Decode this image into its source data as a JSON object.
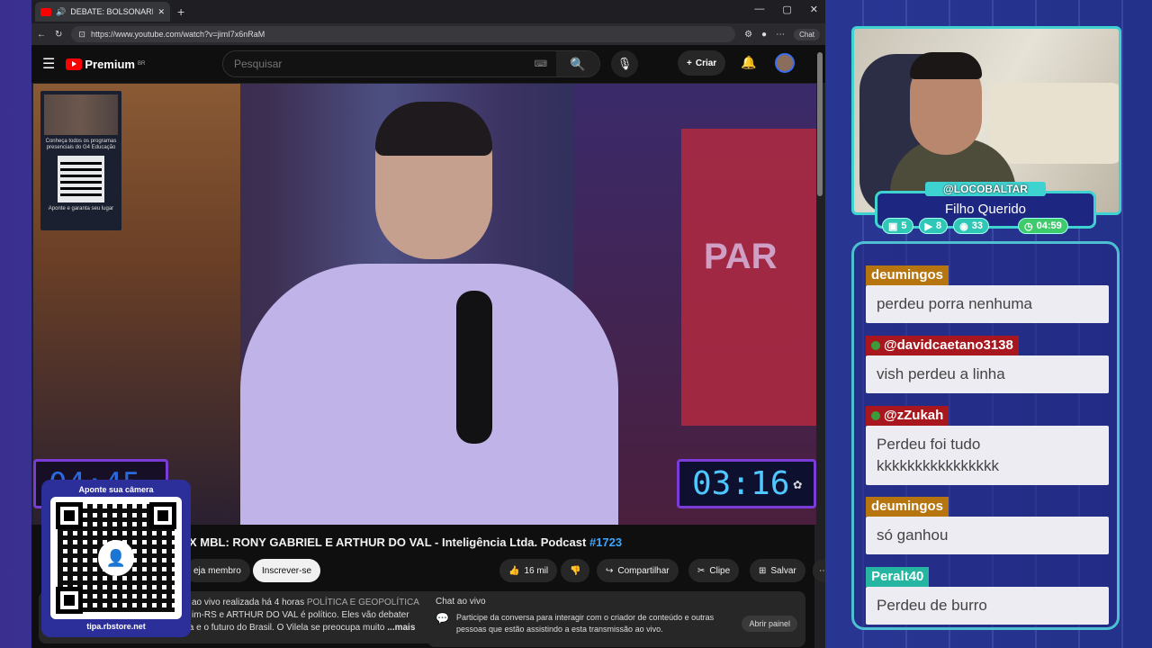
{
  "browser": {
    "tab_title": "DEBATE: BOLSONARISTA X MBL",
    "new_tab": "+",
    "win_min": "—",
    "win_max": "▢",
    "win_close": "✕",
    "url": "https://www.youtube.com/watch?v=jimI7x6nRaM",
    "chat_label": "Chat"
  },
  "youtube": {
    "logo_text": "Premium",
    "logo_region": "BR",
    "search_placeholder": "Pesquisar",
    "create_label": "Criar",
    "video": {
      "promo_text": "Conheça todos os programas presenciais do G4 Educação",
      "promo_footer": "Aponte e garanta seu lugar",
      "timer_left": "04:45",
      "timer_right": "03:16",
      "sign_text": "PAR"
    },
    "title_main": "X MBL: RONY GABRIEL E ARTHUR DO VAL - Inteligência Ltda. Podcast",
    "title_tag": "#1723",
    "actions": {
      "member": "eja membro",
      "subscribe": "Inscrever-se",
      "likes": "16 mil",
      "share": "Compartilhar",
      "clip": "Clipe",
      "save": "Salvar",
      "more": "⋯"
    },
    "description": {
      "line1": "ao vivo realizada há 4 horas",
      "category": "POLÍTICA E GEOPOLÍTICA",
      "line2": "im-RS e ARTHUR DO VAL é político. Eles vão debater",
      "line3": "sobre Bolsonaro, a política da direita e o futuro do Brasil. O Vilela se preocupa muito",
      "more": "...mais"
    },
    "live_chat": {
      "header": "Chat ao vivo",
      "text": "Participe da conversa para interagir com o criador de conteúdo e outras pessoas que estão assistindo a esta transmissão ao vivo.",
      "open_button": "Abrir painel"
    }
  },
  "qr_overlay": {
    "top_text": "Aponte sua câmera",
    "bottom_text": "tipa.rbstore.net"
  },
  "streamer": {
    "handle": "@LOCOBALTAR",
    "subtitle": "Filho Querido",
    "stats": [
      {
        "icon": "twitch-icon",
        "value": "5"
      },
      {
        "icon": "youtube-icon",
        "value": "8"
      },
      {
        "icon": "kick-icon",
        "value": "33"
      },
      {
        "icon": "clock-icon",
        "value": "04:59"
      }
    ]
  },
  "chat": [
    {
      "user": "deumingos",
      "message": "perdeu porra nenhuma",
      "color": "#b7750f",
      "badge": false
    },
    {
      "user": "@davidcaetano3138",
      "message": "vish perdeu a linha",
      "color": "#a7171d",
      "badge": true
    },
    {
      "user": "@zZukah",
      "message": "Perdeu foi tudo kkkkkkkkkkkkkkkk",
      "color": "#a7171d",
      "badge": true
    },
    {
      "user": "deumingos",
      "message": "só ganhou",
      "color": "#b7750f",
      "badge": false
    },
    {
      "user": "Peralt40",
      "message": "Perdeu de burro",
      "color": "#26b5a0",
      "badge": false
    }
  ]
}
